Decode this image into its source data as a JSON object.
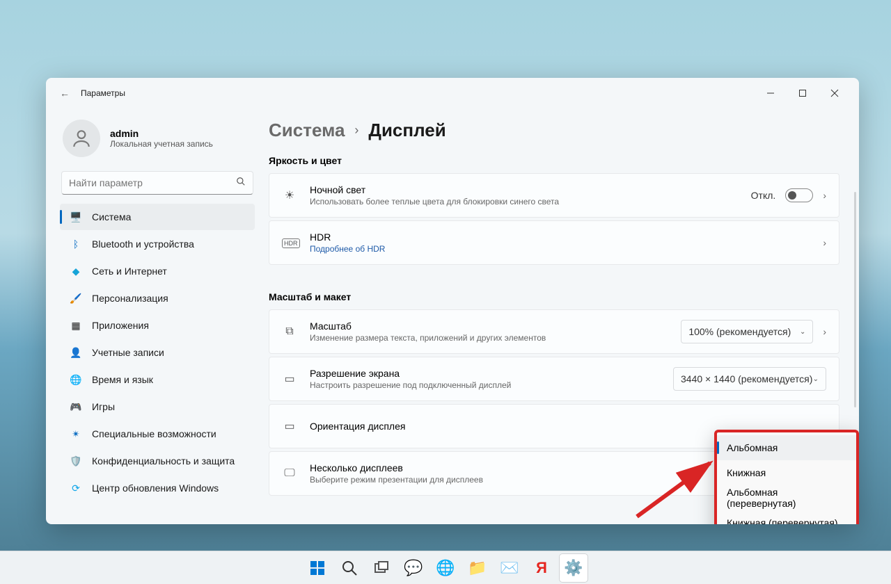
{
  "window_title": "Параметры",
  "account": {
    "name": "admin",
    "sub": "Локальная учетная запись"
  },
  "search_placeholder": "Найти параметр",
  "nav": [
    {
      "label": "Система"
    },
    {
      "label": "Bluetooth и устройства"
    },
    {
      "label": "Сеть и Интернет"
    },
    {
      "label": "Персонализация"
    },
    {
      "label": "Приложения"
    },
    {
      "label": "Учетные записи"
    },
    {
      "label": "Время и язык"
    },
    {
      "label": "Игры"
    },
    {
      "label": "Специальные возможности"
    },
    {
      "label": "Конфиденциальность и защита"
    },
    {
      "label": "Центр обновления Windows"
    }
  ],
  "breadcrumb": {
    "a": "Система",
    "b": "Дисплей"
  },
  "sections": {
    "brightness": "Яркость и цвет",
    "scale": "Масштаб и макет"
  },
  "cards": {
    "nightlight": {
      "title": "Ночной свет",
      "sub": "Использовать более теплые цвета для блокировки синего света",
      "state": "Откл."
    },
    "hdr": {
      "title": "HDR",
      "sub": "Подробнее об HDR",
      "badge": "HDR"
    },
    "scale": {
      "title": "Масштаб",
      "sub": "Изменение размера текста, приложений и других элементов",
      "value": "100% (рекомендуется)"
    },
    "resolution": {
      "title": "Разрешение экрана",
      "sub": "Настроить разрешение под подключенный дисплей",
      "value": "3440 × 1440 (рекомендуется)"
    },
    "orientation": {
      "title": "Ориентация дисплея"
    },
    "multi": {
      "title": "Несколько дисплеев",
      "sub": "Выберите режим презентации для дисплеев"
    }
  },
  "orientation_menu": [
    "Альбомная",
    "Книжная",
    "Альбомная (перевернутая)",
    "Книжная (перевернутая)"
  ]
}
